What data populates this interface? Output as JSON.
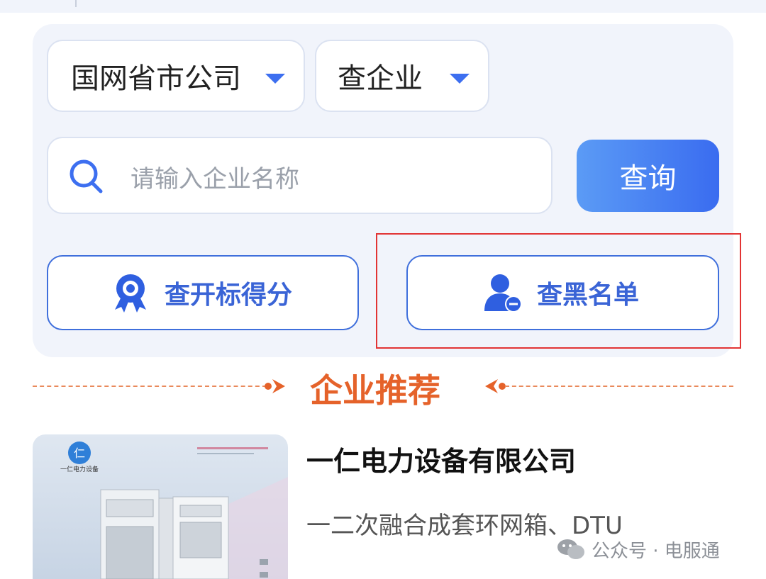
{
  "filters": {
    "company_select": "国网省市公司",
    "query_type_select": "查企业"
  },
  "search": {
    "placeholder": "请输入企业名称",
    "button_label": "查询"
  },
  "actions": {
    "bid_score_label": "查开标得分",
    "blacklist_label": "查黑名单"
  },
  "section": {
    "title": "企业推荐"
  },
  "recommendations": [
    {
      "name": "一仁电力设备有限公司",
      "description": "一二次融合成套环网箱、DTU",
      "thumb_brand": "一仁电力设备"
    }
  ],
  "watermark": {
    "text": "公众号 · 电服通"
  },
  "colors": {
    "accent": "#3a6cf0",
    "section_title": "#e5622a",
    "highlight_box": "#e23434"
  }
}
